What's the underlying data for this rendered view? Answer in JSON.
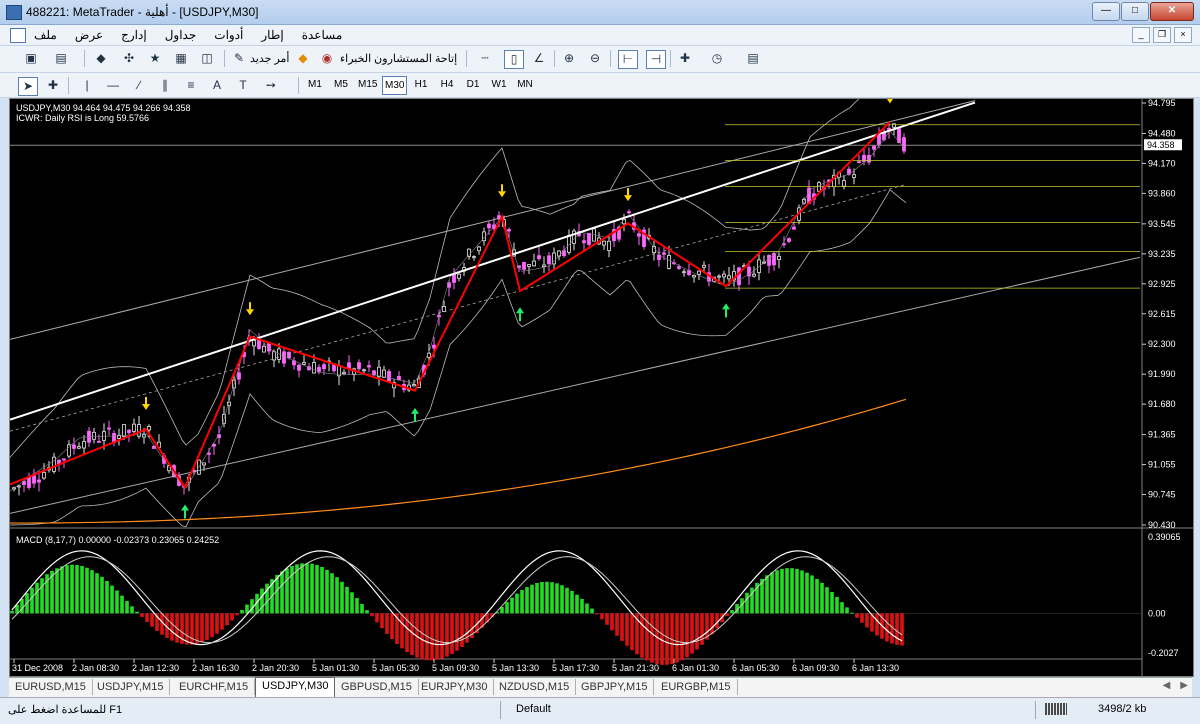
{
  "window": {
    "title": "488221: MetaTrader - أهلية - [USDJPY,M30]"
  },
  "menu": {
    "items": [
      "ملف",
      "عرض",
      "إدارج",
      "جداول",
      "أدوات",
      "إطار",
      "مساعدة"
    ]
  },
  "toolbar": {
    "new_order": "أمر جديد",
    "experts": "إتاحة المستشارون الخبراء"
  },
  "timeframes": [
    "M1",
    "M5",
    "M15",
    "M30",
    "H1",
    "H4",
    "D1",
    "W1",
    "MN"
  ],
  "active_timeframe": "M30",
  "chart": {
    "symbol_line": "USDJPY,M30  94.464 94.475 94.266 94.358",
    "indicator_line": "ICWR: Daily RSI is Long 59.5766",
    "price_labels": [
      "94.795",
      "94.480",
      "94.170",
      "93.860",
      "93.545",
      "93.235",
      "92.925",
      "92.615",
      "92.300",
      "91.990",
      "91.680",
      "91.365",
      "91.055",
      "90.745",
      "90.430"
    ],
    "current_price": "94.358",
    "macd_label": "MACD (8,17,7) 0.00000 -0.02373 0.23065 0.24252",
    "macd_levels": [
      "0.39065",
      "0.00",
      "-0.2027"
    ],
    "time_labels": [
      "31 Dec 2008",
      "2 Jan 08:30",
      "2 Jan 12:30",
      "2 Jan 16:30",
      "2 Jan 20:30",
      "5 Jan 01:30",
      "5 Jan 05:30",
      "5 Jan 09:30",
      "5 Jan 13:30",
      "5 Jan 17:30",
      "5 Jan 21:30",
      "6 Jan 01:30",
      "6 Jan 05:30",
      "6 Jan 09:30",
      "6 Jan 13:30"
    ],
    "colors": {
      "bull": "#e6e6e6",
      "bear": "#ff66ff",
      "zigzag": "#ff0000",
      "macd_pos": "#22dd22",
      "macd_neg": "#dd1111",
      "fib": "#c8c830",
      "ma": "#ff8c1a"
    }
  },
  "chart_data": {
    "type": "candlestick",
    "symbol": "USDJPY",
    "timeframe": "M30",
    "ylim": [
      90.43,
      94.795
    ],
    "last_ohlc": {
      "open": 94.464,
      "high": 94.475,
      "low": 94.266,
      "close": 94.358
    },
    "macd": {
      "params": [
        8,
        17,
        7
      ],
      "values": [
        0.0,
        -0.02373,
        0.23065,
        0.24252
      ],
      "ylim": [
        -0.2027,
        0.39065
      ]
    }
  },
  "tabs": [
    "EURUSD,M15",
    "USDJPY,M15",
    "EURCHF,M15",
    "USDJPY,M30",
    "GBPUSD,M15",
    "EURJPY,M30",
    "NZDUSD,M15",
    "GBPJPY,M15",
    "EURGBP,M15"
  ],
  "active_tab": "USDJPY,M30",
  "status": {
    "help": "للمساعدة اضغط على F1",
    "profile": "Default",
    "traffic": "3498/2 kb"
  }
}
